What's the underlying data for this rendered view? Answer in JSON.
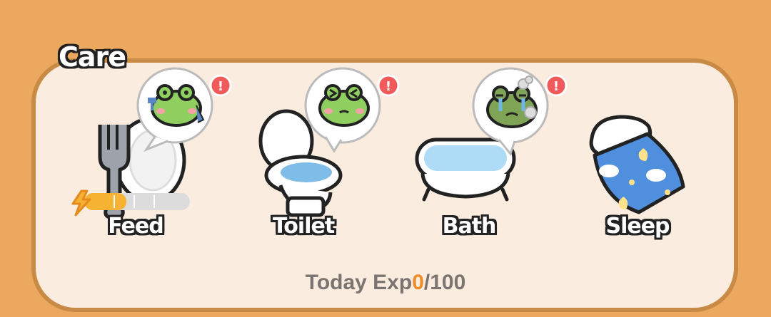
{
  "section": {
    "title": "Care"
  },
  "items": [
    {
      "label": "Feed",
      "alert": "!",
      "energy_level": 0.4
    },
    {
      "label": "Toilet",
      "alert": "!"
    },
    {
      "label": "Bath",
      "alert": "!"
    },
    {
      "label": "Sleep"
    }
  ],
  "exp": {
    "prefix": "Today Exp",
    "current": "0",
    "max": "/100"
  },
  "colors": {
    "background": "#eda85f",
    "panel": "#fbece0",
    "accent": "#f08c28",
    "alert": "#f05a5a"
  },
  "icons": [
    "fork-plate-icon",
    "toilet-icon",
    "bathtub-icon",
    "pillow-blanket-icon",
    "frog-face-icon",
    "alert-icon",
    "lightning-icon"
  ]
}
